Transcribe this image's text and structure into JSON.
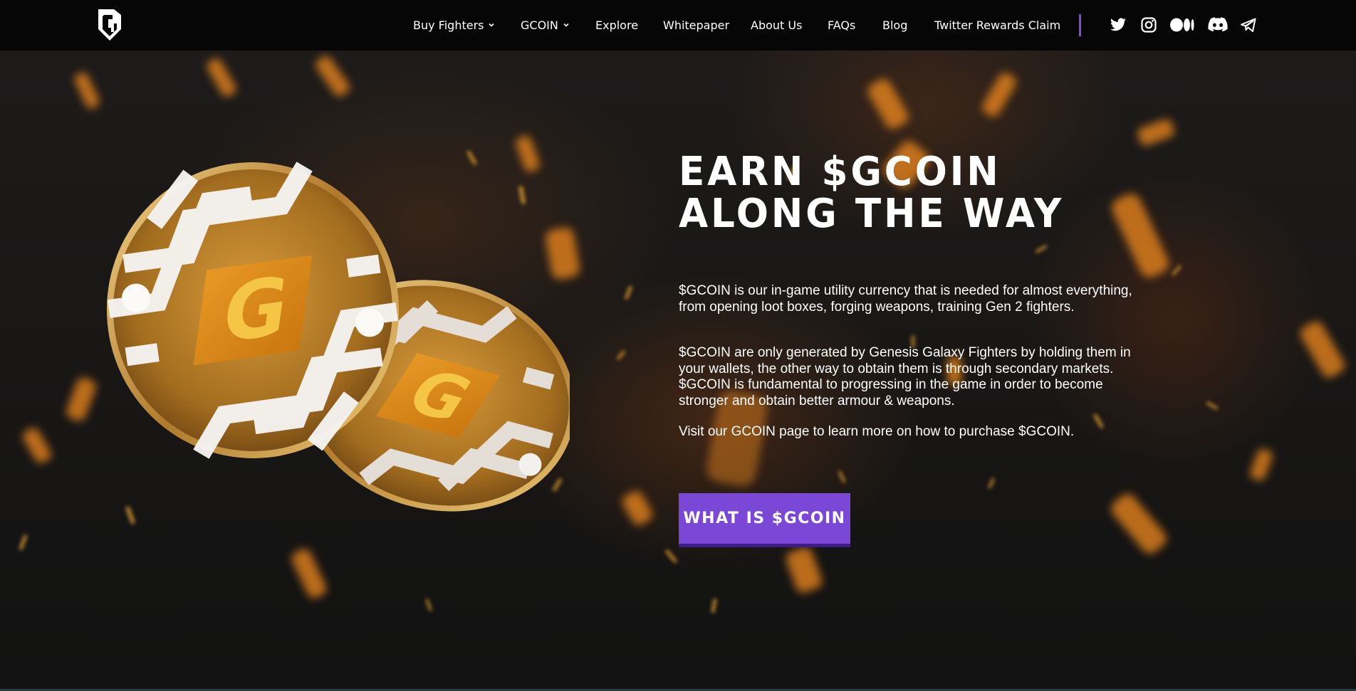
{
  "header": {
    "logo_icon": "gg-shield-logo-icon",
    "nav": [
      {
        "label": "Buy Fighters",
        "has_dropdown": true
      },
      {
        "label": "GCOIN",
        "has_dropdown": true
      },
      {
        "label": "Explore",
        "has_dropdown": false
      },
      {
        "label": "Whitepaper",
        "has_dropdown": false
      },
      {
        "label": "About Us",
        "has_dropdown": false
      },
      {
        "label": "FAQs",
        "has_dropdown": false
      },
      {
        "label": "Blog",
        "has_dropdown": false
      },
      {
        "label": "Twitter Rewards Claim",
        "has_dropdown": false
      }
    ],
    "social": [
      "twitter-icon",
      "instagram-icon",
      "medium-icon",
      "discord-icon",
      "telegram-icon"
    ]
  },
  "hero": {
    "headline_line1": "EARN $GCOIN",
    "headline_line2": "ALONG THE WAY",
    "paragraph1": "$GCOIN is our in-game utility currency that is needed for almost everything, from opening loot boxes, forging weapons, training Gen 2 fighters.",
    "paragraph2": "$GCOIN are only generated by Genesis Galaxy Fighters by holding them in your wallets, the other way to obtain them is through secondary markets. $GCOIN is fundamental to progressing in the game in order to become stronger and obtain better armour & weapons.",
    "paragraph3": "Visit our GCOIN page to learn more on how to purchase $GCOIN.",
    "cta_label": "WHAT IS $GCOIN",
    "coin_letter": "G"
  },
  "colors": {
    "accent": "#7a47d6",
    "background": "#141414",
    "coin_gold": "#c9902a",
    "coin_orange": "#e38a16"
  }
}
